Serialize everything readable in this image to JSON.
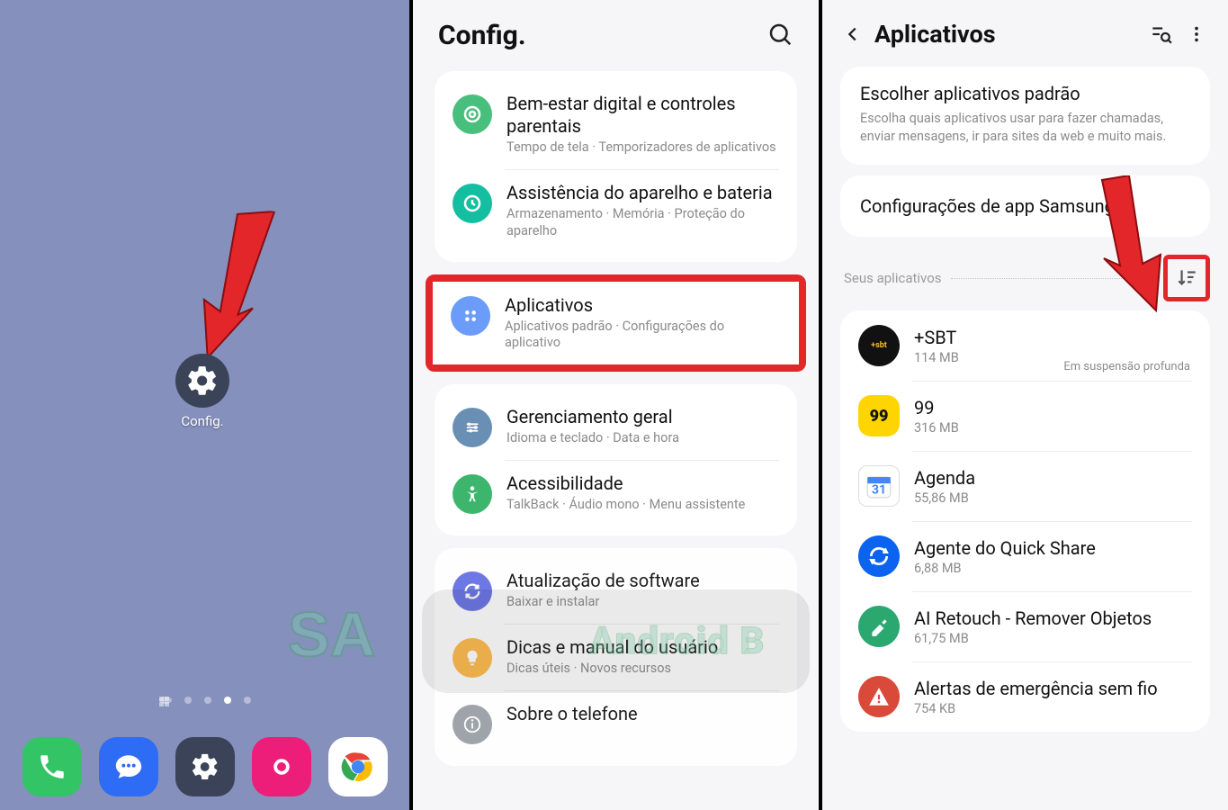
{
  "panelA": {
    "appLabel": "Config."
  },
  "panelB": {
    "title": "Config.",
    "card1": [
      {
        "title": "Bem-estar digital e controles parentais",
        "sub": "Tempo de tela · Temporizadores de aplicativos"
      },
      {
        "title": "Assistência do aparelho e bateria",
        "sub": "Armazenamento · Memória · Proteção do aparelho"
      }
    ],
    "highlighted": {
      "title": "Aplicativos",
      "sub": "Aplicativos padrão · Configurações do aplicativo"
    },
    "card2": [
      {
        "title": "Gerenciamento geral",
        "sub": "Idioma e teclado · Data e hora"
      },
      {
        "title": "Acessibilidade",
        "sub": "TalkBack · Áudio mono · Menu assistente"
      }
    ],
    "card3": [
      {
        "title": "Atualização de software",
        "sub": "Baixar e instalar"
      },
      {
        "title": "Dicas e manual do usuário",
        "sub": "Dicas úteis · Novos recursos"
      },
      {
        "title": "Sobre o telefone",
        "sub": ""
      }
    ]
  },
  "panelC": {
    "title": "Aplicativos",
    "defaultCard": {
      "title": "Escolher aplicativos padrão",
      "sub": "Escolha quais aplicativos usar para fazer chamadas, enviar mensagens, ir para sites da web e muito mais."
    },
    "samsungCard": "Configurações de app Samsung",
    "sectionLabel": "Seus aplicativos",
    "deepSleep": "Em suspensão profunda",
    "apps": [
      {
        "name": "+SBT",
        "size": "114 MB",
        "status": true
      },
      {
        "name": "99",
        "size": "316 MB"
      },
      {
        "name": "Agenda",
        "size": "55,86 MB"
      },
      {
        "name": "Agente do Quick Share",
        "size": "6,88 MB"
      },
      {
        "name": "AI Retouch - Remover Objetos",
        "size": "61,75 MB"
      },
      {
        "name": "Alertas de emergência sem fio",
        "size": "754 KB"
      }
    ]
  },
  "watermark": {
    "a": "SA",
    "b": "Android B"
  }
}
